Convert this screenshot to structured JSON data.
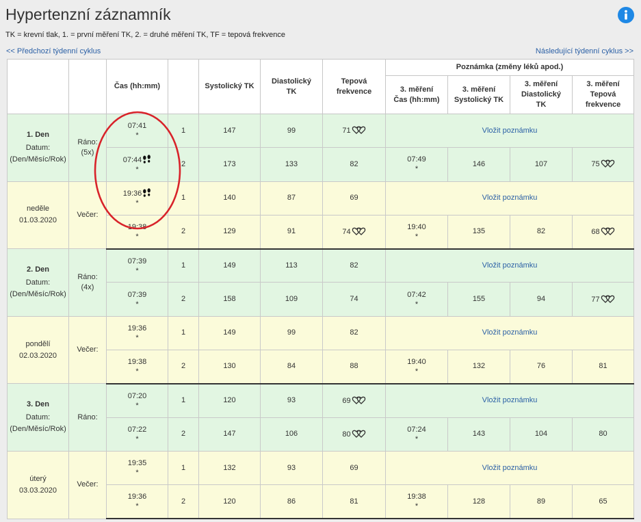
{
  "page": {
    "title": "Hypertenzní záznamník",
    "legend": "TK = krevní tlak, 1. = první měření TK, 2. = druhé měření TK, TF = tepová frekvence",
    "prev_link": "<< Předchozí týdenní cyklus",
    "next_link": "Následující týdenní cyklus >>",
    "info_icon": "info-icon"
  },
  "colors": {
    "morning_row": "#e2f6e2",
    "evening_row": "#fbfbda",
    "link": "#2a5fa5",
    "info_icon": "#1e88e5",
    "day_separator": "#333333",
    "annotation_circle": "#d8232a"
  },
  "table": {
    "headers": {
      "time": [
        "Čas (hh:mm)"
      ],
      "systolic": [
        "Systolický TK"
      ],
      "diastolic": [
        "Diastolický",
        "TK"
      ],
      "pulse": [
        "Tepová",
        "frekvence"
      ],
      "note_group": "Poznámka (změny léků apod.)",
      "third_time": [
        "3. měření",
        "Čas (hh:mm)"
      ],
      "third_systolic": [
        "3. měření",
        "Systolický TK"
      ],
      "third_diastolic": [
        "3. měření",
        "Diastolický",
        "TK"
      ],
      "third_pulse": [
        "3. měření",
        "Tepová",
        "frekvence"
      ]
    },
    "add_note_label": "Vložit poznámku",
    "days": [
      {
        "label": "1. Den",
        "date_caption": "Datum:",
        "date_format": "(Den/Měsíc/Rok)",
        "weekday": "neděle",
        "date": "01.03.2020",
        "periods": [
          {
            "label": "Ráno:",
            "count": "(5x)",
            "rows": [
              {
                "time": "07:41",
                "marker": "*",
                "num": "1",
                "systolic": "147",
                "diastolic": "99",
                "pulse": "71",
                "pulse_icon": "double-heart-icon"
              },
              {
                "time": "07:44",
                "time_icon": "footprints-icon",
                "marker": "*",
                "num": "2",
                "systolic": "173",
                "diastolic": "133",
                "pulse": "82",
                "third": {
                  "time": "07:49",
                  "marker": "*",
                  "systolic": "146",
                  "diastolic": "107",
                  "pulse": "75",
                  "pulse_icon": "double-heart-icon"
                }
              }
            ]
          },
          {
            "label": "Večer:",
            "rows": [
              {
                "time": "19:36",
                "time_icon": "footprints-icon",
                "marker": "*",
                "num": "1",
                "systolic": "140",
                "diastolic": "87",
                "pulse": "69"
              },
              {
                "time": "19:38",
                "marker": "*",
                "num": "2",
                "systolic": "129",
                "diastolic": "91",
                "pulse": "74",
                "pulse_icon": "double-heart-icon",
                "third": {
                  "time": "19:40",
                  "marker": "*",
                  "systolic": "135",
                  "diastolic": "82",
                  "pulse": "68",
                  "pulse_icon": "double-heart-icon"
                }
              }
            ]
          }
        ]
      },
      {
        "label": "2. Den",
        "date_caption": "Datum:",
        "date_format": "(Den/Měsíc/Rok)",
        "weekday": "pondělí",
        "date": "02.03.2020",
        "periods": [
          {
            "label": "Ráno:",
            "count": "(4x)",
            "rows": [
              {
                "time": "07:39",
                "marker": "*",
                "num": "1",
                "systolic": "149",
                "diastolic": "113",
                "pulse": "82"
              },
              {
                "time": "07:39",
                "marker": "*",
                "num": "2",
                "systolic": "158",
                "diastolic": "109",
                "pulse": "74",
                "third": {
                  "time": "07:42",
                  "marker": "*",
                  "systolic": "155",
                  "diastolic": "94",
                  "pulse": "77",
                  "pulse_icon": "double-heart-icon"
                }
              }
            ]
          },
          {
            "label": "Večer:",
            "rows": [
              {
                "time": "19:36",
                "marker": "*",
                "num": "1",
                "systolic": "149",
                "diastolic": "99",
                "pulse": "82"
              },
              {
                "time": "19:38",
                "marker": "*",
                "num": "2",
                "systolic": "130",
                "diastolic": "84",
                "pulse": "88",
                "third": {
                  "time": "19:40",
                  "marker": "*",
                  "systolic": "132",
                  "diastolic": "76",
                  "pulse": "81"
                }
              }
            ]
          }
        ]
      },
      {
        "label": "3. Den",
        "date_caption": "Datum:",
        "date_format": "(Den/Měsíc/Rok)",
        "weekday": "úterý",
        "date": "03.03.2020",
        "periods": [
          {
            "label": "Ráno:",
            "rows": [
              {
                "time": "07:20",
                "marker": "*",
                "num": "1",
                "systolic": "120",
                "diastolic": "93",
                "pulse": "69",
                "pulse_icon": "double-heart-icon"
              },
              {
                "time": "07:22",
                "marker": "*",
                "num": "2",
                "systolic": "147",
                "diastolic": "106",
                "pulse": "80",
                "pulse_icon": "double-heart-icon",
                "third": {
                  "time": "07:24",
                  "marker": "*",
                  "systolic": "143",
                  "diastolic": "104",
                  "pulse": "80"
                }
              }
            ]
          },
          {
            "label": "Večer:",
            "rows": [
              {
                "time": "19:35",
                "marker": "*",
                "num": "1",
                "systolic": "132",
                "diastolic": "93",
                "pulse": "69"
              },
              {
                "time": "19:36",
                "marker": "*",
                "num": "2",
                "systolic": "120",
                "diastolic": "86",
                "pulse": "81",
                "third": {
                  "time": "19:38",
                  "marker": "*",
                  "systolic": "128",
                  "diastolic": "89",
                  "pulse": "65"
                }
              }
            ]
          }
        ]
      }
    ]
  }
}
